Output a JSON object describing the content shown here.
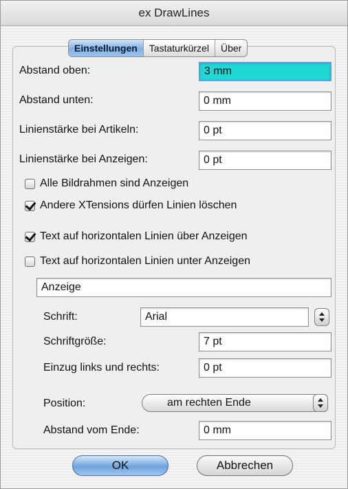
{
  "window": {
    "title": "ex DrawLines"
  },
  "tabs": {
    "items": [
      "Einstellungen",
      "Tastaturkürzel",
      "Über"
    ],
    "active": "Einstellungen"
  },
  "settings": {
    "abstand_oben_label": "Abstand oben:",
    "abstand_oben_value": "3 mm",
    "abstand_unten_label": "Abstand unten:",
    "abstand_unten_value": "0 mm",
    "linienstaerke_artikel_label": "Linienstärke bei Artikeln:",
    "linienstaerke_artikel_value": "0 pt",
    "linienstaerke_anzeigen_label": "Linienstärke bei Anzeigen:",
    "linienstaerke_anzeigen_value": "0 pt"
  },
  "checkboxes": {
    "bildrahmen": {
      "label": "Alle Bildrahmen sind Anzeigen",
      "checked": false
    },
    "xtensions": {
      "label": "Andere XTensions dürfen Linien löschen",
      "checked": true
    },
    "text_ueber": {
      "label": "Text auf horizontalen Linien über Anzeigen",
      "checked": true
    },
    "text_unter": {
      "label": "Text auf horizontalen Linien unter Anzeigen",
      "checked": false
    }
  },
  "text_options": {
    "text_value": "Anzeige",
    "schrift_label": "Schrift:",
    "schrift_value": "Arial",
    "schriftgroesse_label": "Schriftgröße:",
    "schriftgroesse_value": "7 pt",
    "einzug_label": "Einzug links und rechts:",
    "einzug_value": "0 pt",
    "position_label": "Position:",
    "position_value": "am rechten Ende",
    "abstand_ende_label": "Abstand vom Ende:",
    "abstand_ende_value": "0 mm"
  },
  "buttons": {
    "ok": "OK",
    "cancel": "Abbrechen"
  },
  "colors": {
    "focus_field": "#1fd8d6",
    "default_button": "#6ea4dd",
    "active_tab": "#7fb0e4"
  }
}
